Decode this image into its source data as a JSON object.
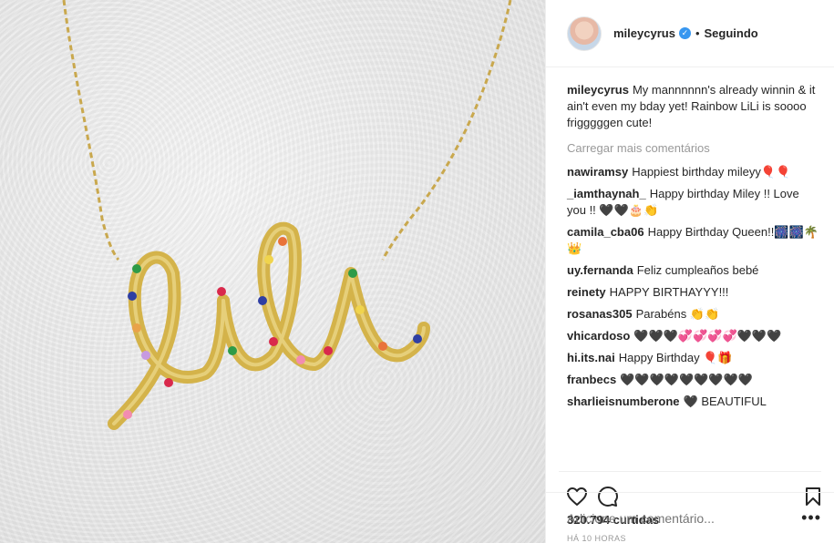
{
  "header": {
    "username": "mileycyrus",
    "separator": "•",
    "follow_state": "Seguindo"
  },
  "caption": {
    "username": "mileycyrus",
    "text": "My mannnnnn's already winnin & it ain't even my bday yet! Rainbow LiLi is soooo frigggggen cute!"
  },
  "load_more": "Carregar mais comentários",
  "comments": [
    {
      "username": "nawiramsy",
      "text": "Happiest birthday mileyy🎈🎈"
    },
    {
      "username": "_iamthaynah_",
      "text": "Happy birthday Miley !! Love you !! 🖤🖤🎂👏"
    },
    {
      "username": "camila_cba06",
      "text": "Happy Birthday Queen!!🎆🎆🌴👑"
    },
    {
      "username": "uy.fernanda",
      "text": "Feliz cumpleaños bebé"
    },
    {
      "username": "reinety",
      "text": "HAPPY BIRTHAYYY!!!"
    },
    {
      "username": "rosanas305",
      "text": "Parabéns 👏👏"
    },
    {
      "username": "vhicardoso",
      "text": "🖤🖤🖤💞💞💞💞🖤🖤🖤"
    },
    {
      "username": "hi.its.nai",
      "text": "Happy Birthday 🎈🎁"
    },
    {
      "username": "franbecs",
      "text": "🖤🖤🖤🖤🖤🖤🖤🖤🖤"
    },
    {
      "username": "sharlieisnumberone",
      "text": "🖤 BEAUTIFUL"
    }
  ],
  "likes": "320.794 curtidas",
  "timestamp": "HÁ 10 HORAS",
  "add_comment": {
    "placeholder": "Adicione um comentário...",
    "more": "•••"
  },
  "icons": {
    "heart": "heart-icon",
    "comment": "comment-icon",
    "bookmark": "bookmark-icon",
    "verified": "verified-badge-icon"
  }
}
